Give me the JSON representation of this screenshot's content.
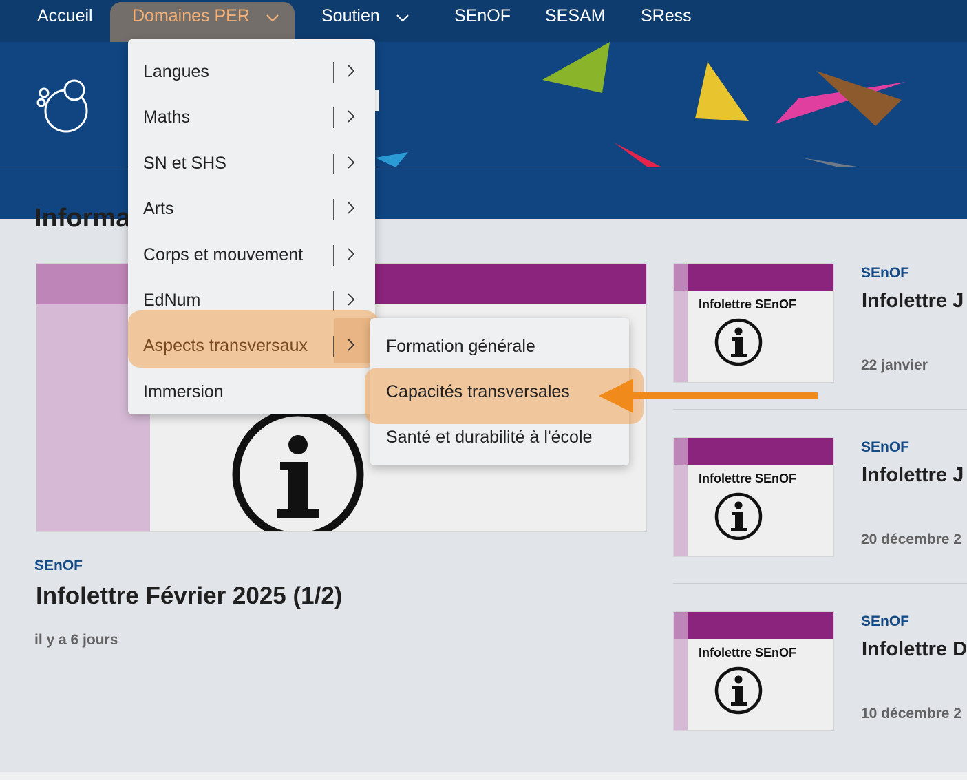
{
  "nav": {
    "items": [
      {
        "label": "Accueil"
      },
      {
        "label": "Domaines PER"
      },
      {
        "label": "Soutien"
      },
      {
        "label": "SEnOF"
      },
      {
        "label": "SESAM"
      },
      {
        "label": "SRess"
      }
    ]
  },
  "dropdown": {
    "items": [
      {
        "label": "Langues"
      },
      {
        "label": "Maths"
      },
      {
        "label": "SN et SHS"
      },
      {
        "label": "Arts"
      },
      {
        "label": "Corps et mouvement"
      },
      {
        "label": "EdNum"
      },
      {
        "label": "Aspects transversaux"
      },
      {
        "label": "Immersion"
      }
    ],
    "submenu": [
      {
        "label": "Formation générale"
      },
      {
        "label": "Capacités transversales"
      },
      {
        "label": "Santé et durabilité à l'école"
      }
    ]
  },
  "content": {
    "section_title": "Informati",
    "featured": {
      "kicker": "SEnOF",
      "title": "Infolettre Février 2025 (1/2)",
      "date": "il y a 6 jours"
    },
    "side_articles": [
      {
        "thumb_label": "Infolettre SEnOF",
        "kicker": "SEnOF",
        "title": "Infolettre J",
        "date": "22 janvier"
      },
      {
        "thumb_label": "Infolettre SEnOF",
        "kicker": "SEnOF",
        "title": "Infolettre J",
        "date": "20 décembre 2"
      },
      {
        "thumb_label": "Infolettre SEnOF",
        "kicker": "SEnOF",
        "title": "Infolettre D",
        "date": "10 décembre 2"
      }
    ]
  },
  "colors": {
    "nav_bg": "#0e3c6f",
    "banner_bg": "#104581",
    "highlight": "#f2aa64",
    "arrow": "#f08a1a",
    "kicker": "#144a86",
    "magenta": "#8b247c"
  }
}
